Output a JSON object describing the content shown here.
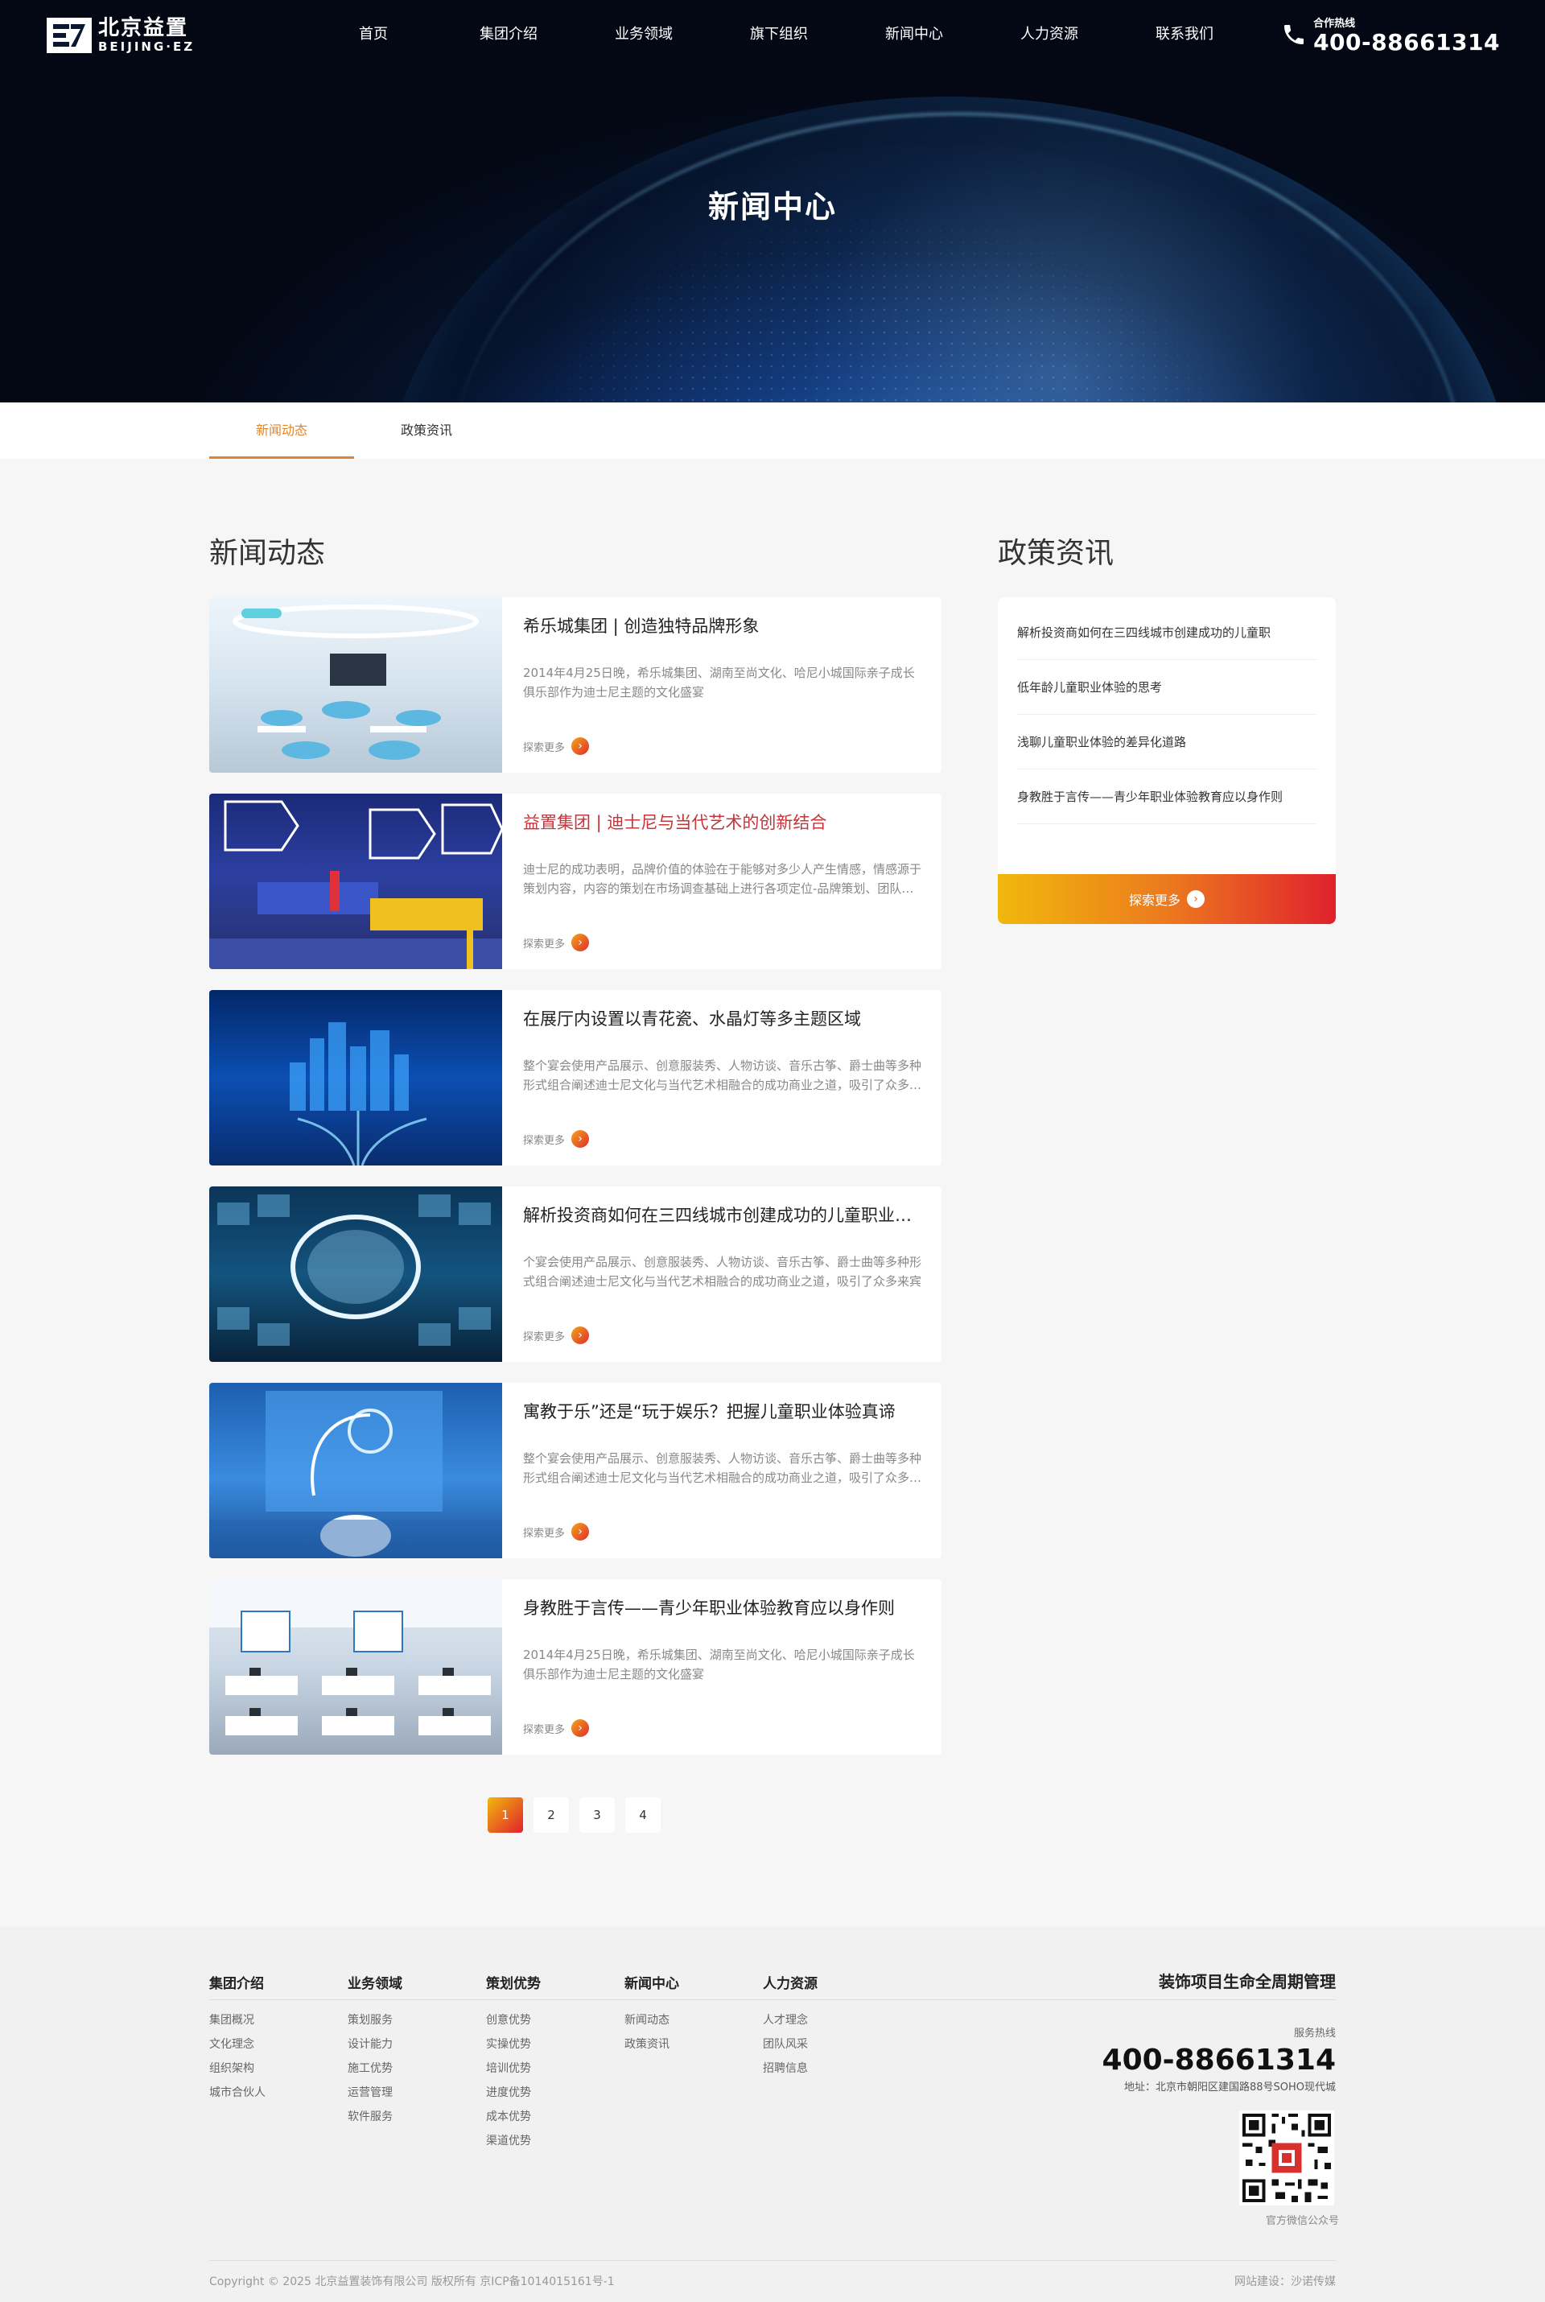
{
  "brand": {
    "name_cn": "北京益置",
    "name_en": "BEIJING·EZ"
  },
  "nav": [
    "首页",
    "集团介绍",
    "业务领域",
    "旗下组织",
    "新闻中心",
    "人力资源",
    "联系我们"
  ],
  "hotline": {
    "label": "合作热线",
    "number": "400-88661314"
  },
  "hero": {
    "title": "新闻中心"
  },
  "tabs": [
    {
      "label": "新闻动态",
      "active": true
    },
    {
      "label": "政策资讯",
      "active": false
    }
  ],
  "news": {
    "heading": "新闻动态",
    "more_label": "探索更多",
    "items": [
      {
        "title": "希乐城集团 | 创造独特品牌形象",
        "summary": "2014年4月25日晚，希乐城集团、湖南至尚文化、哈尼小城国际亲子成长俱乐部作为迪士尼主题的文化盛宴",
        "highlight": false
      },
      {
        "title": "益置集团 | 迪士尼与当代艺术的创新结合",
        "summary": "迪士尼的成功表明，品牌价值的体验在于能够对多少人产生情感，情感源于策划内容，内容的策划在市场调查基础上进行各项定位-品牌策划、团队组建、人才培训",
        "highlight": true
      },
      {
        "title": "在展厅内设置以青花瓷、水晶灯等多主题区域",
        "summary": "整个宴会使用产品展示、创意服装秀、人物访谈、音乐古筝、爵士曲等多种形式组合阐述迪士尼文化与当代艺术相融合的成功商业之道，吸引了众多来宾",
        "highlight": false
      },
      {
        "title": "解析投资商如何在三四线城市创建成功的儿童职业体验馆",
        "summary": "个宴会使用产品展示、创意服装秀、人物访谈、音乐古筝、爵士曲等多种形式组合阐述迪士尼文化与当代艺术相融合的成功商业之道，吸引了众多来宾",
        "highlight": false
      },
      {
        "title": "寓教于乐”还是“玩于娱乐？把握儿童职业体验真谛",
        "summary": "整个宴会使用产品展示、创意服装秀、人物访谈、音乐古筝、爵士曲等多种形式组合阐述迪士尼文化与当代艺术相融合的成功商业之道，吸引了众多来宾",
        "highlight": false
      },
      {
        "title": "身教胜于言传——青少年职业体验教育应以身作则",
        "summary": "2014年4月25日晚，希乐城集团、湖南至尚文化、哈尼小城国际亲子成长俱乐部作为迪士尼主题的文化盛宴",
        "highlight": false
      }
    ]
  },
  "policy": {
    "heading": "政策资讯",
    "items": [
      "解析投资商如何在三四线城市创建成功的儿童职",
      "低年龄儿童职业体验的思考",
      "浅聊儿童职业体验的差异化道路",
      "身教胜于言传——青少年职业体验教育应以身作则"
    ],
    "more_label": "探索更多"
  },
  "pagination": {
    "pages": [
      "1",
      "2",
      "3",
      "4"
    ],
    "current": "1"
  },
  "footer": {
    "columns": [
      {
        "title": "集团介绍",
        "links": [
          "集团概况",
          "文化理念",
          "组织架构",
          "城市合伙人"
        ]
      },
      {
        "title": "业务领域",
        "links": [
          "策划服务",
          "设计能力",
          "施工优势",
          "运营管理",
          "软件服务"
        ]
      },
      {
        "title": "策划优势",
        "links": [
          "创意优势",
          "实操优势",
          "培训优势",
          "进度优势",
          "成本优势",
          "渠道优势"
        ]
      },
      {
        "title": "新闻中心",
        "links": [
          "新闻动态",
          "政策资讯"
        ]
      },
      {
        "title": "人力资源",
        "links": [
          "人才理念",
          "团队风采",
          "招聘信息"
        ]
      }
    ],
    "slogan": "装饰项目生命全周期管理",
    "service_label": "服务热线",
    "service_number": "400-88661314",
    "address": "地址：北京市朝阳区建国路88号SOHO现代城",
    "qr_caption": "官方微信公众号",
    "copyright": "Copyright © 2025 北京益置装饰有限公司 版权所有 京ICP备1014015161号-1",
    "builder": "网站建设：沙诺传媒"
  },
  "colors": {
    "accent_orange": "#e0852a",
    "accent_red": "#e0212d",
    "highlight_title": "#c4343b"
  }
}
